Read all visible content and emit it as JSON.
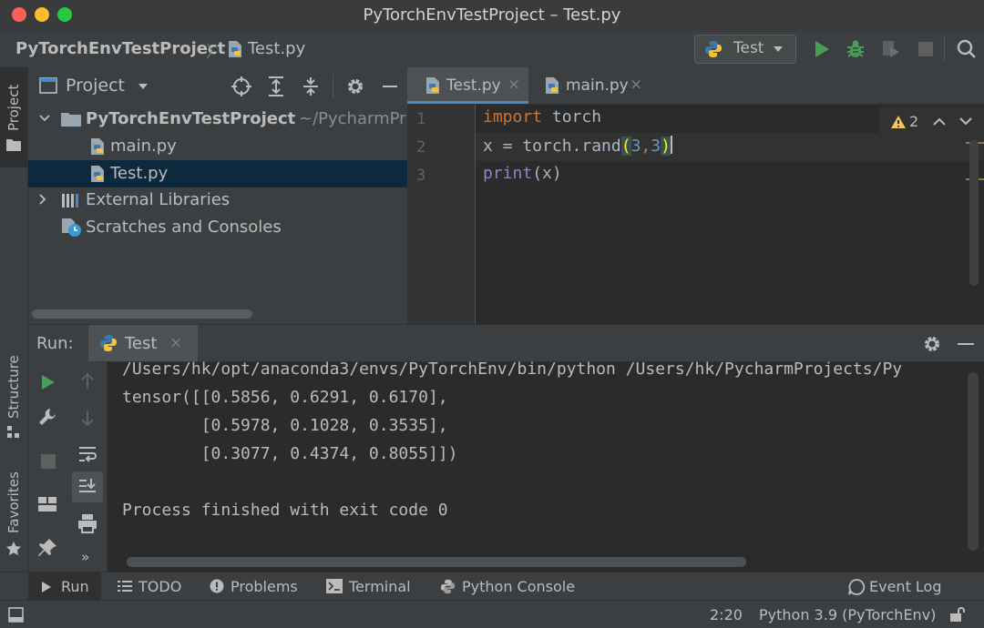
{
  "window": {
    "title": "PyTorchEnvTestProject – Test.py"
  },
  "navbar": {
    "project": "PyTorchEnvTestProject",
    "separator": "〉",
    "file": "Test.py",
    "run_config": "Test"
  },
  "left_stripe": {
    "project": "Project",
    "structure": "Structure",
    "favorites": "Favorites"
  },
  "project_panel": {
    "title": "Project",
    "tree": {
      "root": "PyTorchEnvTestProject",
      "root_path": "~/PycharmPr",
      "files": [
        "main.py",
        "Test.py"
      ],
      "external": "External Libraries",
      "scratches": "Scratches and Consoles"
    }
  },
  "editor": {
    "tabs": [
      "Test.py",
      "main.py"
    ],
    "warning_count": "2",
    "line_numbers": [
      "1",
      "2",
      "3"
    ],
    "line1": {
      "kw": "import",
      "rest": " torch"
    },
    "line2": {
      "a": "x = torch.rand",
      "open": "(",
      "n1": "3",
      "comma": ",",
      "n2": "3",
      "close": ")"
    },
    "line3": {
      "fn": "print",
      "rest": "(x)"
    }
  },
  "run_panel": {
    "label": "Run:",
    "tab": "Test",
    "output": [
      "/Users/hk/opt/anaconda3/envs/PyTorchEnv/bin/python /Users/hk/PycharmProjects/Py",
      "tensor([[0.5856, 0.6291, 0.6170],",
      "        [0.5978, 0.1028, 0.3535],",
      "        [0.3077, 0.4374, 0.8055]])",
      "",
      "Process finished with exit code 0"
    ]
  },
  "tool_windows": {
    "run": "Run",
    "todo": "TODO",
    "problems": "Problems",
    "terminal": "Terminal",
    "python_console": "Python Console",
    "event_log": "Event Log"
  },
  "status": {
    "position": "2:20",
    "interpreter": "Python 3.9 (PyTorchEnv)"
  },
  "colors": {
    "keyword": "#cc7832",
    "number": "#6897bb",
    "builtin": "#8888c6",
    "run_green": "#499c54",
    "selection": "#0d293e"
  }
}
